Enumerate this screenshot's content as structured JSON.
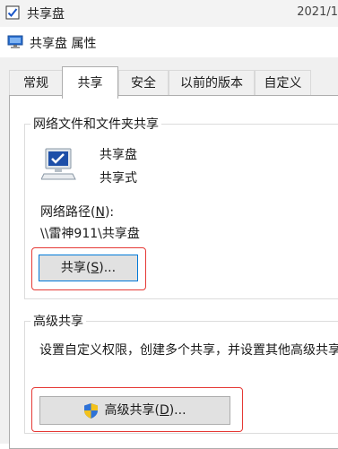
{
  "background": {
    "title": "共享盘",
    "date": "2021/1"
  },
  "window": {
    "title": "共享盘 属性"
  },
  "tabs": [
    {
      "label": "常规"
    },
    {
      "label": "共享"
    },
    {
      "label": "安全"
    },
    {
      "label": "以前的版本"
    },
    {
      "label": "自定义"
    }
  ],
  "sharing": {
    "group_title": "网络文件和文件夹共享",
    "folder_name": "共享盘",
    "share_status": "共享式",
    "network_path_label_pre": "网络路径(",
    "network_path_label_key": "N",
    "network_path_label_post": "):",
    "network_path": "\\\\雷神911\\共享盘",
    "share_button": {
      "pre": "共享(",
      "key": "S",
      "post": ")..."
    }
  },
  "advanced": {
    "group_title": "高级共享",
    "description": "设置自定义权限，创建多个共享，并设置其他高级共享选项。",
    "button": {
      "pre": "高级共享(",
      "key": "D",
      "post": ")..."
    }
  },
  "colors": {
    "highlight_box": "#e53935",
    "focus_border": "#0078d7"
  }
}
